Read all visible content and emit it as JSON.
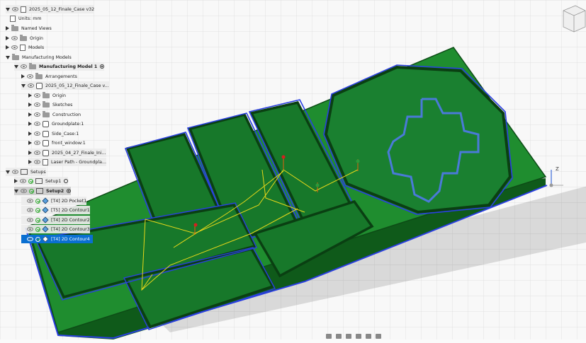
{
  "browser": {
    "document_title": "2025_05_12_Finale_Case v32",
    "units": "Units: mm",
    "named_views": "Named Views",
    "origin": "Origin",
    "models": "Models",
    "manufacturing_models": "Manufacturing Models",
    "manufacturing_model_1": "Manufacturing Model 1",
    "arrangements": "Arrangements",
    "component": "2025_05_12_Finale_Case v...",
    "children": [
      "Origin",
      "Sketches",
      "Construction",
      "Groundplate:1",
      "Side_Case:1",
      "front_window:1",
      "2025_04_27_Finale_Ini...",
      "Laser Path - Groundpla..."
    ],
    "setups": "Setups",
    "setup1": "Setup1",
    "setup2": "Setup2",
    "operations": [
      "[T4] 2D Pocket1",
      "[T5] 2D Contour1",
      "[T4] 2D Contour2",
      "[T4] 2D Contour3",
      "[T4] 2D Contour4"
    ]
  },
  "axis": {
    "z": "Z"
  },
  "colors": {
    "board": "#1e8a2e",
    "board_edge": "#0f5a1a",
    "toolpath_blue": "#2a3fe0",
    "rapid_yellow": "#e8d81a",
    "selection": "#0a6fd1"
  }
}
